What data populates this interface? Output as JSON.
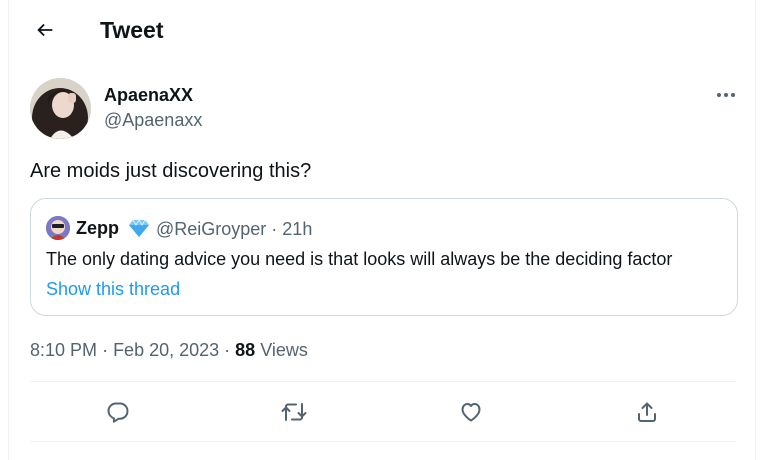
{
  "header": {
    "title": "Tweet"
  },
  "tweet": {
    "author_name": "ApaenaXX",
    "author_handle": "@Apaenaxx",
    "text": "Are moids just discovering this?",
    "time": "8:10 PM",
    "date": "Feb 20, 2023",
    "views_count": "88",
    "views_label": "Views"
  },
  "quote": {
    "name": "Zepp",
    "handle_time": "@ReiGroyper · 21h",
    "text": "The only dating advice you need is that looks will always be the deciding factor",
    "link_label": "Show this thread"
  },
  "colors": {
    "accent": "#1d9bf0",
    "secondary_text": "#536471",
    "border": "#cfd9de"
  },
  "icons": [
    "back-arrow-icon",
    "more-icon",
    "verified-gem-icon",
    "reply-icon",
    "retweet-icon",
    "like-icon",
    "share-icon"
  ]
}
